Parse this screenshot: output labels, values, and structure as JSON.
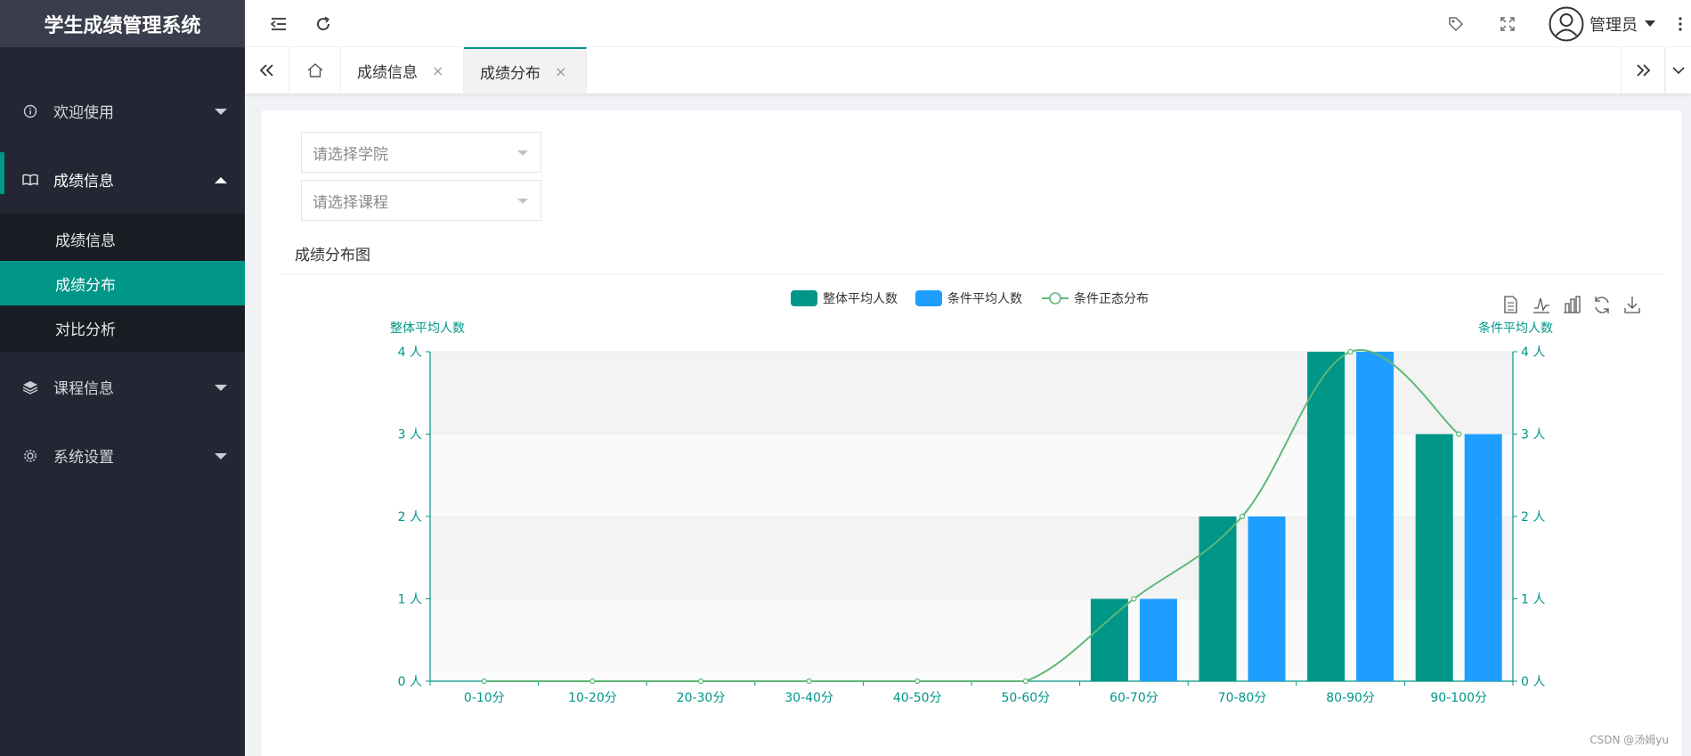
{
  "app": {
    "title": "学生成绩管理系统"
  },
  "sidebar": {
    "items": [
      {
        "label": "欢迎使用",
        "icon": "info-circle-icon",
        "expanded": false
      },
      {
        "label": "成绩信息",
        "icon": "book-icon",
        "expanded": true,
        "children": [
          {
            "label": "成绩信息",
            "selected": false
          },
          {
            "label": "成绩分布",
            "selected": true
          },
          {
            "label": "对比分析",
            "selected": false
          }
        ]
      },
      {
        "label": "课程信息",
        "icon": "layers-icon",
        "expanded": false
      },
      {
        "label": "系统设置",
        "icon": "gear-icon",
        "expanded": false
      }
    ]
  },
  "header": {
    "user_name": "管理员"
  },
  "tabs": [
    {
      "label": "成绩信息",
      "active": false
    },
    {
      "label": "成绩分布",
      "active": true
    }
  ],
  "filters": {
    "college_placeholder": "请选择学院",
    "course_placeholder": "请选择课程"
  },
  "panel": {
    "title": "成绩分布图"
  },
  "chart_data": {
    "type": "bar",
    "categories": [
      "0-10分",
      "10-20分",
      "20-30分",
      "30-40分",
      "40-50分",
      "50-60分",
      "60-70分",
      "70-80分",
      "80-90分",
      "90-100分"
    ],
    "series": [
      {
        "name": "整体平均人数",
        "type": "bar",
        "color": "#009688",
        "values": [
          0,
          0,
          0,
          0,
          0,
          0,
          1,
          2,
          4,
          3
        ]
      },
      {
        "name": "条件平均人数",
        "type": "bar",
        "color": "#1E9FFF",
        "values": [
          0,
          0,
          0,
          0,
          0,
          0,
          1,
          2,
          4,
          3
        ]
      },
      {
        "name": "条件正态分布",
        "type": "line",
        "smooth": true,
        "color": "#5FB878",
        "values": [
          0,
          0,
          0,
          0,
          0,
          0,
          1,
          2,
          4,
          3
        ]
      }
    ],
    "ylabel_left": "整体平均人数",
    "ylabel_right": "条件平均人数",
    "yticks": [
      "0 人",
      "1 人",
      "2 人",
      "3 人",
      "4 人"
    ],
    "ylim": [
      0,
      4
    ],
    "legend_position": "top-center",
    "axis_color": "#009688",
    "toolbox": [
      "data-view-icon",
      "line-chart-icon",
      "bar-chart-icon",
      "restore-icon",
      "download-icon"
    ]
  },
  "watermark": "CSDN @汤姆yu"
}
